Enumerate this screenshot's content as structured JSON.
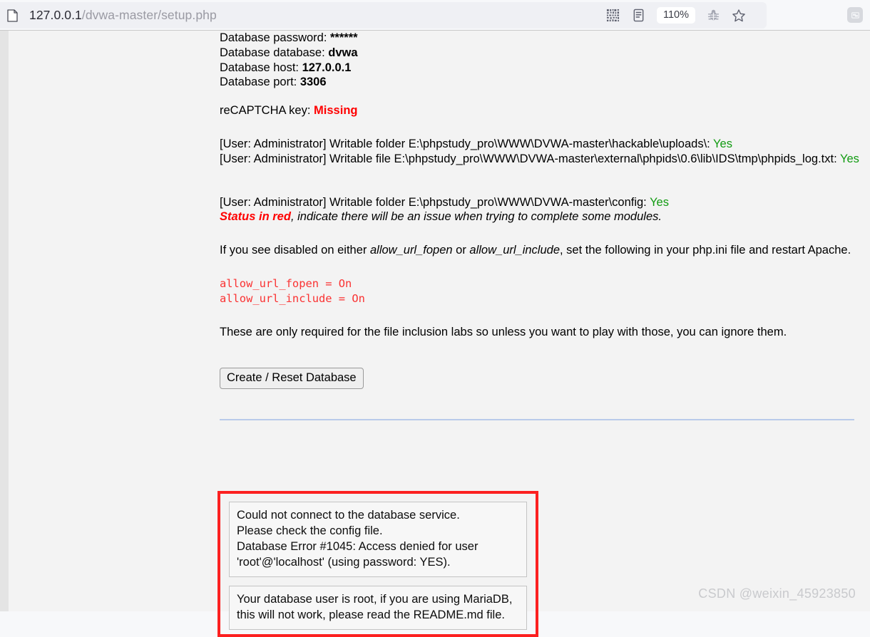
{
  "browser": {
    "url_host": "127.0.0.1",
    "url_path": "/dvwa-master/setup.php",
    "page_icon": "page-icon",
    "toolbar_icons": [
      {
        "name": "qr-code-icon",
        "label": "QR"
      },
      {
        "name": "reader-view-icon",
        "label": "Reader"
      },
      {
        "name": "zoom-level-badge",
        "label": "110%"
      },
      {
        "name": "bug-icon",
        "label": "Bug"
      },
      {
        "name": "bookmark-star-icon",
        "label": "Star"
      }
    ],
    "zoom_level": "110%",
    "extension_icon": "extension-icon"
  },
  "setup": {
    "db_password_label": "Database password: ",
    "db_password_value": "******",
    "db_database_label": "Database database: ",
    "db_database_value": "dvwa",
    "db_host_label": "Database host: ",
    "db_host_value": "127.0.0.1",
    "db_port_label": "Database port: ",
    "db_port_value": "3306",
    "recaptcha_label": "reCAPTCHA key: ",
    "recaptcha_value": "Missing",
    "writable_uploads": "[User: Administrator] Writable folder E:\\phpstudy_pro\\WWW\\DVWA-master\\hackable\\uploads\\: ",
    "writable_uploads_status": "Yes",
    "writable_phpids": "[User: Administrator] Writable file E:\\phpstudy_pro\\WWW\\DVWA-master\\external\\phpids\\0.6\\lib\\IDS\\tmp\\phpids_log.txt: ",
    "writable_phpids_status": "Yes",
    "writable_config": "[User: Administrator] Writable folder E:\\phpstudy_pro\\WWW\\DVWA-master\\config: ",
    "writable_config_status": "Yes",
    "status_red_bold": "Status in red",
    "status_red_rest": ", indicate there will be an issue when trying to complete some modules.",
    "allow_url_intro_1": "If you see disabled on either ",
    "allow_url_fopen_em": "allow_url_fopen",
    "allow_url_intro_2": " or ",
    "allow_url_include_em": "allow_url_include",
    "allow_url_intro_3": ", set the following in your php.ini file and restart Apache.",
    "ini_settings": "allow_url_fopen = On\nallow_url_include = On",
    "file_inclusion_note": "These are only required for the file inclusion labs so unless you want to play with those, you can ignore them.",
    "create_reset_button": "Create / Reset Database"
  },
  "errors": {
    "card_1": "Could not connect to the database service.\nPlease check the config file.\nDatabase Error #1045: Access denied for user 'root'@'localhost' (using password: YES).",
    "card_2": "Your database user is root, if you are using MariaDB, this will not work, please read the README.md file."
  },
  "watermark": "CSDN @weixin_45923850",
  "colors": {
    "error_highlight": "#fc2020",
    "status_ok": "#119b11",
    "status_missing": "#ff0000",
    "code_red": "#fa3232",
    "divider": "#b9caea"
  }
}
